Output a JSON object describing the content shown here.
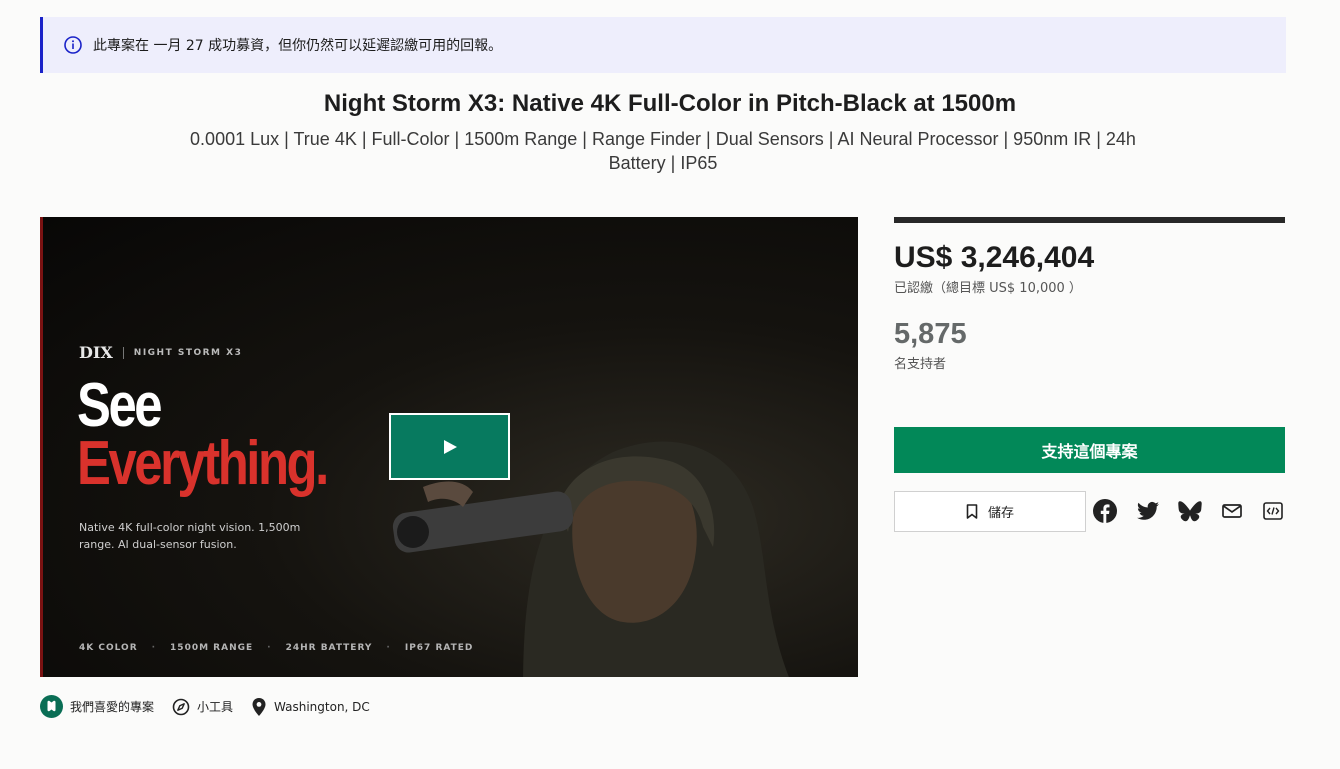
{
  "notice": {
    "text": "此專案在 一月 27 成功募資，但你仍然可以延遲認繳可用的回報。"
  },
  "project": {
    "title": "Night Storm X3: Native 4K Full-Color in Pitch-Black at 1500m",
    "blurb": "0.0001 Lux | True 4K | Full-Color | 1500m Range | Range Finder | Dual Sensors | AI Neural Processor | 950nm IR | 24h Battery | IP65"
  },
  "video": {
    "brand": "DIX",
    "model": "NIGHT STORM X3",
    "headline_1": "See",
    "headline_2": "Everything.",
    "tagline": "Native 4K full-color night vision. 1,500m range. AI dual-sensor fusion.",
    "features": [
      "4K COLOR",
      "1500M RANGE",
      "24HR BATTERY",
      "IP67 RATED"
    ],
    "feature_separator": "·"
  },
  "stats": {
    "pledged": "US$ 3,246,404",
    "pledged_label": "已認繳（總目標 US$ 10,000 ）",
    "backers": "5,875",
    "backers_label": "名支持者"
  },
  "actions": {
    "back_label": "支持這個專案",
    "save_label": "儲存"
  },
  "share_icons": [
    "facebook-icon",
    "twitter-icon",
    "bluesky-icon",
    "email-icon",
    "embed-icon"
  ],
  "meta": {
    "badge_label": "我們喜愛的專案",
    "category_label": "小工具",
    "location_label": "Washington, DC"
  },
  "colors": {
    "accent_green": "#028858",
    "notice_bg": "#eeeefc",
    "notice_border": "#1a22c8",
    "headline_red": "#d9322c",
    "play_button": "#077a5f"
  }
}
